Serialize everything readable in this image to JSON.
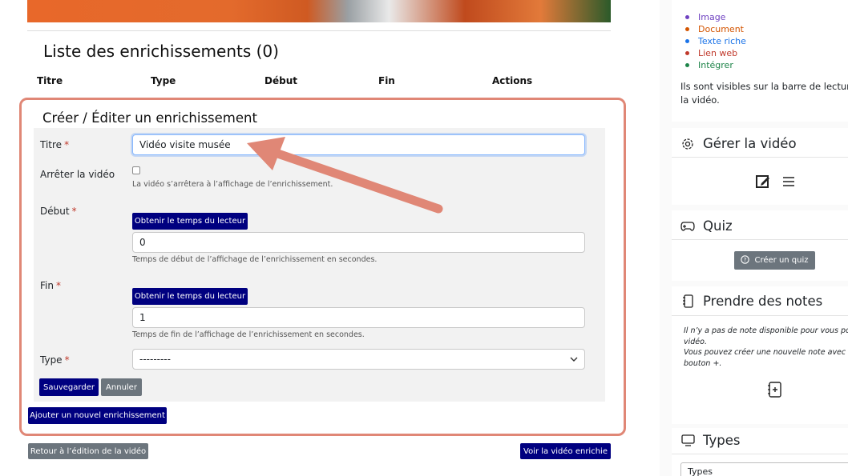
{
  "list": {
    "title": "Liste des enrichissements (0)",
    "columns": [
      "Titre",
      "Type",
      "Début",
      "Fin",
      "Actions"
    ]
  },
  "form": {
    "title": "Créer / Éditer un enrichissement",
    "titre_label": "Titre",
    "titre_value": "Vidéo visite musée",
    "stop_label": "Arrêter la vidéo",
    "stop_help": "La vidéo s’arrêtera à l’affichage de l’enrichissement.",
    "debut_label": "Début",
    "debut_button": "Obtenir le temps du lecteur",
    "debut_value": "0",
    "debut_help": "Temps de début de l’affichage de l’enrichissement en secondes.",
    "fin_label": "Fin",
    "fin_button": "Obtenir le temps du lecteur",
    "fin_value": "1",
    "fin_help": "Temps de fin de l’affichage de l’enrichissement en secondes.",
    "type_label": "Type",
    "type_value": "---------",
    "required_mark": "*",
    "save_label": "Sauvegarder",
    "cancel_label": "Annuler"
  },
  "add_new_label": "Ajouter un nouvel enrichissement",
  "back_label": "Retour à l’édition de la vidéo",
  "view_label": "Voir la vidéo enrichie",
  "sidebar": {
    "legend": [
      {
        "label": "Image",
        "color": "#6f42c1"
      },
      {
        "label": "Document",
        "color": "#d35400"
      },
      {
        "label": "Texte riche",
        "color": "#1a73e8"
      },
      {
        "label": "Lien web",
        "color": "#c0392b"
      },
      {
        "label": "Intégrer",
        "color": "#1e8449"
      }
    ],
    "visible_text_1": "Ils sont visibles sur la barre de lecture",
    "visible_text_2": "la vidéo.",
    "manage_title": "Gérer la vidéo",
    "quiz_title": "Quiz",
    "quiz_button": "Créer un quiz",
    "notes_title": "Prendre des notes",
    "notes_text_1": "Il n’y a pas de note disponible pour vous pour c",
    "notes_text_2": "vidéo.",
    "notes_text_3": "Vous pouvez créer une nouvelle note avec le",
    "notes_text_4": "bouton +.",
    "types_title": "Types",
    "types_select": "Types"
  },
  "colors": {
    "navy": "#000080",
    "gray": "#6c757d",
    "highlight": "#e08776",
    "required": "#c0392b"
  }
}
